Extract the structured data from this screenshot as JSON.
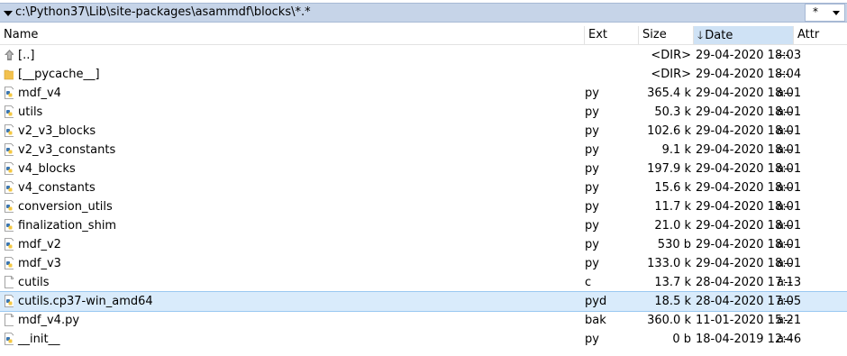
{
  "path": "c:\\Python37\\Lib\\site-packages\\asammdf\\blocks\\*.*",
  "filter": "*",
  "columns": {
    "name": "Name",
    "ext": "Ext",
    "size": "Size",
    "date": "Date",
    "attr": "Attr"
  },
  "rows": [
    {
      "icon": "up-dir-icon",
      "name": "[..]",
      "ext": "",
      "size": "<DIR>",
      "date": "29-04-2020 18:03",
      "attr": "---"
    },
    {
      "icon": "folder-icon",
      "name": "[__pycache__]",
      "ext": "",
      "size": "<DIR>",
      "date": "29-04-2020 18:04",
      "attr": "---"
    },
    {
      "icon": "python-file-icon",
      "name": "mdf_v4",
      "ext": "py",
      "size": "365.4 k",
      "date": "29-04-2020 18:01",
      "attr": "a--"
    },
    {
      "icon": "python-file-icon",
      "name": "utils",
      "ext": "py",
      "size": "50.3 k",
      "date": "29-04-2020 18:01",
      "attr": "a--"
    },
    {
      "icon": "python-file-icon",
      "name": "v2_v3_blocks",
      "ext": "py",
      "size": "102.6 k",
      "date": "29-04-2020 18:01",
      "attr": "a--"
    },
    {
      "icon": "python-file-icon",
      "name": "v2_v3_constants",
      "ext": "py",
      "size": "9.1 k",
      "date": "29-04-2020 18:01",
      "attr": "a--"
    },
    {
      "icon": "python-file-icon",
      "name": "v4_blocks",
      "ext": "py",
      "size": "197.9 k",
      "date": "29-04-2020 18:01",
      "attr": "a--"
    },
    {
      "icon": "python-file-icon",
      "name": "v4_constants",
      "ext": "py",
      "size": "15.6 k",
      "date": "29-04-2020 18:01",
      "attr": "a--"
    },
    {
      "icon": "python-file-icon",
      "name": "conversion_utils",
      "ext": "py",
      "size": "11.7 k",
      "date": "29-04-2020 18:01",
      "attr": "a--"
    },
    {
      "icon": "python-file-icon",
      "name": "finalization_shim",
      "ext": "py",
      "size": "21.0 k",
      "date": "29-04-2020 18:01",
      "attr": "a--"
    },
    {
      "icon": "python-file-icon",
      "name": "mdf_v2",
      "ext": "py",
      "size": "530 b",
      "date": "29-04-2020 18:01",
      "attr": "a--"
    },
    {
      "icon": "python-file-icon",
      "name": "mdf_v3",
      "ext": "py",
      "size": "133.0 k",
      "date": "29-04-2020 18:01",
      "attr": "a--"
    },
    {
      "icon": "blank-file-icon",
      "name": "cutils",
      "ext": "c",
      "size": "13.7 k",
      "date": "28-04-2020 17:13",
      "attr": "a--"
    },
    {
      "icon": "python-file-icon",
      "name": "cutils.cp37-win_amd64",
      "ext": "pyd",
      "size": "18.5 k",
      "date": "28-04-2020 17:05",
      "attr": "a--",
      "selected": true
    },
    {
      "icon": "blank-file-icon",
      "name": "mdf_v4.py",
      "ext": "bak",
      "size": "360.0 k",
      "date": "11-01-2020 15:21",
      "attr": "a--"
    },
    {
      "icon": "python-file-icon",
      "name": "__init__",
      "ext": "py",
      "size": "0 b",
      "date": "18-04-2019 12:46",
      "attr": "a--"
    }
  ],
  "colors": {
    "pathbar": "#c6d4e8",
    "sorted_header": "#cfe2f5",
    "selected_row": "#d9ebfb",
    "folder": "#f2c14e"
  }
}
